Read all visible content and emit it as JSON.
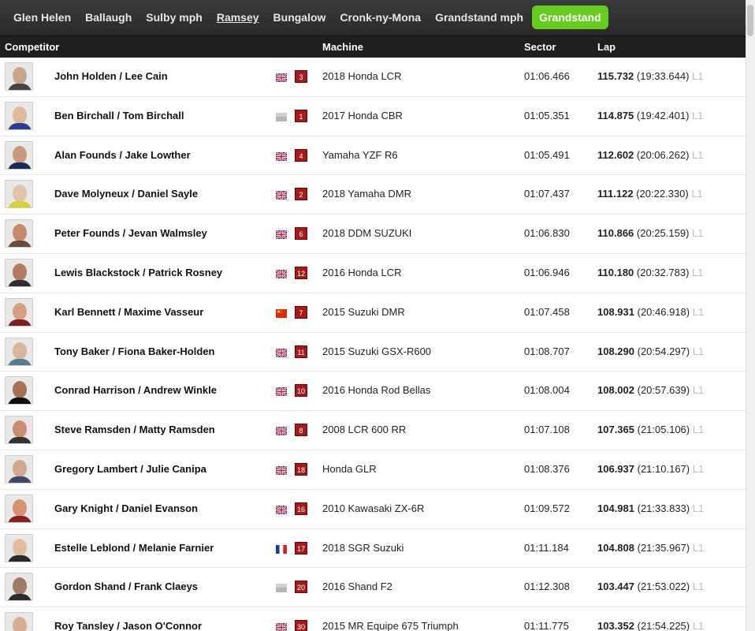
{
  "tabs": [
    {
      "label": "Glen Helen"
    },
    {
      "label": "Ballaugh"
    },
    {
      "label": "Sulby mph"
    },
    {
      "label": "Ramsey"
    },
    {
      "label": "Bungalow"
    },
    {
      "label": "Cronk-ny-Mona"
    },
    {
      "label": "Grandstand mph"
    },
    {
      "label": "Grandstand"
    }
  ],
  "active_tab": "Grandstand",
  "underlined_tab": "Ramsey",
  "colors": {
    "active_tab": "#66cc1f",
    "number_badge": "#a41b1b",
    "header_bg": "#1f1f1f"
  },
  "table": {
    "headers": {
      "competitor": "Competitor",
      "machine": "Machine",
      "sector": "Sector",
      "lap": "Lap"
    },
    "rows": [
      {
        "name": "John Holden / Lee Cain",
        "flag": "uk-flag",
        "number": "3",
        "machine": "2018 Honda LCR",
        "sector": "01:06.466",
        "speed": "115.732",
        "laptime": "(19:33.644)",
        "lapno": "L1"
      },
      {
        "name": "Ben Birchall / Tom Birchall",
        "flag": "grey-flag",
        "number": "1",
        "machine": "2017 Honda CBR",
        "sector": "01:05.351",
        "speed": "114.875",
        "laptime": "(19:42.401)",
        "lapno": "L1"
      },
      {
        "name": "Alan Founds / Jake Lowther",
        "flag": "uk-flag",
        "number": "4",
        "machine": "Yamaha YZF R6",
        "sector": "01:05.491",
        "speed": "112.602",
        "laptime": "(20:06.262)",
        "lapno": "L1"
      },
      {
        "name": "Dave Molyneux / Daniel Sayle",
        "flag": "uk-flag",
        "number": "2",
        "machine": "2018 Yamaha DMR",
        "sector": "01:07.437",
        "speed": "111.122",
        "laptime": "(20:22.330)",
        "lapno": "L1"
      },
      {
        "name": "Peter Founds / Jevan Walmsley",
        "flag": "uk-flag",
        "number": "6",
        "machine": "2018 DDM SUZUKI",
        "sector": "01:06.830",
        "speed": "110.866",
        "laptime": "(20:25.159)",
        "lapno": "L1"
      },
      {
        "name": "Lewis Blackstock / Patrick Rosney",
        "flag": "uk-flag",
        "number": "12",
        "machine": "2016 Honda LCR",
        "sector": "01:06.946",
        "speed": "110.180",
        "laptime": "(20:32.783)",
        "lapno": "L1"
      },
      {
        "name": "Karl Bennett / Maxime Vasseur",
        "flag": "china-flag",
        "number": "7",
        "machine": "2015 Suzuki DMR",
        "sector": "01:07.458",
        "speed": "108.931",
        "laptime": "(20:46.918)",
        "lapno": "L1"
      },
      {
        "name": "Tony Baker / Fiona Baker-Holden",
        "flag": "uk-flag",
        "number": "11",
        "machine": "2015 Suzuki GSX-R600",
        "sector": "01:08.707",
        "speed": "108.290",
        "laptime": "(20:54.297)",
        "lapno": "L1"
      },
      {
        "name": "Conrad Harrison / Andrew Winkle",
        "flag": "uk-flag",
        "number": "10",
        "machine": "2016 Honda Rod Bellas",
        "sector": "01:08.004",
        "speed": "108.002",
        "laptime": "(20:57.639)",
        "lapno": "L1"
      },
      {
        "name": "Steve Ramsden / Matty Ramsden",
        "flag": "uk-flag",
        "number": "8",
        "machine": "2008 LCR 600 RR",
        "sector": "01:07.108",
        "speed": "107.365",
        "laptime": "(21:05.106)",
        "lapno": "L1"
      },
      {
        "name": "Gregory Lambert / Julie Canipa",
        "flag": "uk-flag",
        "number": "18",
        "machine": "Honda GLR",
        "sector": "01:08.376",
        "speed": "106.937",
        "laptime": "(21:10.167)",
        "lapno": "L1"
      },
      {
        "name": "Gary Knight / Daniel Evanson",
        "flag": "uk-flag",
        "number": "16",
        "machine": "2010 Kawasaki ZX-6R",
        "sector": "01:09.572",
        "speed": "104.981",
        "laptime": "(21:33.833)",
        "lapno": "L1"
      },
      {
        "name": "Estelle Leblond / Melanie Farnier",
        "flag": "france-flag",
        "number": "17",
        "machine": "2018 SGR Suzuki",
        "sector": "01:11.184",
        "speed": "104.808",
        "laptime": "(21:35.967)",
        "lapno": "L1"
      },
      {
        "name": "Gordon Shand / Frank Claeys",
        "flag": "grey-flag",
        "number": "20",
        "machine": "2016 Shand F2",
        "sector": "01:12.308",
        "speed": "103.447",
        "laptime": "(21:53.022)",
        "lapno": "L1"
      },
      {
        "name": "Roy Tansley / Jason O'Connor",
        "flag": "uk-flag",
        "number": "30",
        "machine": "2015 MR Equipe 675 Triumph",
        "sector": "01:11.775",
        "speed": "103.352",
        "laptime": "(21:54.225)",
        "lapno": "L1"
      }
    ]
  }
}
